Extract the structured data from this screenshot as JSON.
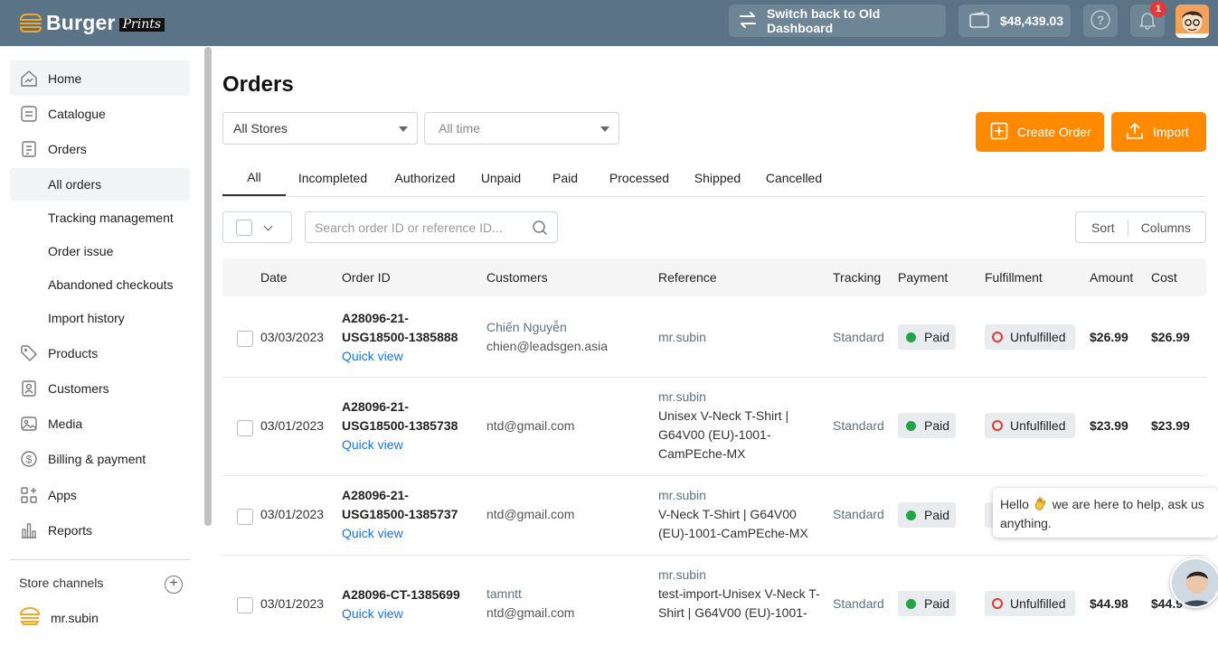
{
  "brand": {
    "name": "Burger",
    "tag": "Prints",
    "accent": "#ff8a00",
    "header_bg": "#5b7386"
  },
  "topbar": {
    "switch_label": "Switch back to Old Dashboard",
    "balance": "$48,439.03",
    "notifications_count": "1"
  },
  "sidebar": {
    "items": [
      {
        "label": "Home",
        "icon": "home-chart-icon"
      },
      {
        "label": "Catalogue",
        "icon": "catalogue-icon"
      },
      {
        "label": "Orders",
        "icon": "orders-icon"
      },
      {
        "label": "Products",
        "icon": "tag-icon"
      },
      {
        "label": "Customers",
        "icon": "customers-icon"
      },
      {
        "label": "Media",
        "icon": "media-icon"
      },
      {
        "label": "Billing & payment",
        "icon": "dollar-icon"
      },
      {
        "label": "Apps",
        "icon": "apps-icon"
      },
      {
        "label": "Reports",
        "icon": "reports-icon"
      }
    ],
    "order_subitems": [
      "All orders",
      "Tracking management",
      "Order issue",
      "Abandoned checkouts",
      "Import history"
    ],
    "store_channels_title": "Store channels",
    "store_name": "mr.subin"
  },
  "page": {
    "title": "Orders",
    "store_filter": "All Stores",
    "time_filter": "All time",
    "create_label": "Create Order",
    "import_label": "Import",
    "search_placeholder": "Search order ID or reference ID...",
    "sort_label": "Sort",
    "columns_label": "Columns"
  },
  "tabs": [
    "All",
    "Incompleted",
    "Authorized",
    "Unpaid",
    "Paid",
    "Processed",
    "Shipped",
    "Cancelled"
  ],
  "table": {
    "headers": [
      "Date",
      "Order ID",
      "Customers",
      "Reference",
      "Tracking",
      "Payment",
      "Fulfillment",
      "Amount",
      "Cost"
    ],
    "rows": [
      {
        "date": "03/03/2023",
        "id1": "A28096-21-",
        "id2": "USG18500-1385888",
        "quick": "Quick view",
        "cust_name": "Chiến Nguyễn",
        "email": "chien@leadsgen.asia",
        "store": "mr.subin",
        "ref": "",
        "tracking": "Standard",
        "payment": "Paid",
        "fulfillment": "Unfulfilled",
        "amount": "$26.99",
        "cost": "$26.99"
      },
      {
        "date": "03/01/2023",
        "id1": "A28096-21-",
        "id2": "USG18500-1385738",
        "quick": "Quick view",
        "cust_name": "",
        "email": "ntd@gmail.com",
        "store": "mr.subin",
        "ref": "Unisex V-Neck T-Shirt | G64V00 (EU)-1001-CamPEche-MX",
        "tracking": "Standard",
        "payment": "Paid",
        "fulfillment": "Unfulfilled",
        "amount": "$23.99",
        "cost": "$23.99"
      },
      {
        "date": "03/01/2023",
        "id1": "A28096-21-",
        "id2": "USG18500-1385737",
        "quick": "Quick view",
        "cust_name": "",
        "email": "ntd@gmail.com",
        "store": "mr.subin",
        "ref": "V-Neck T-Shirt | G64V00 (EU)-1001-CamPEche-MX",
        "tracking": "Standard",
        "payment": "Paid",
        "fulfillment": "",
        "amount": "",
        "cost": ""
      },
      {
        "date": "03/01/2023",
        "id1": "A28096-CT-1385699",
        "id2": "",
        "quick": "Quick view",
        "cust_name": "tamntt",
        "email": "ntd@gmail.com",
        "store": "mr.subin",
        "ref": "test-import-Unisex V-Neck T-Shirt | G64V00 (EU)-1001-",
        "tracking": "Standard",
        "payment": "Paid",
        "fulfillment": "Unfulfilled",
        "amount": "$44.98",
        "cost": "$44.9"
      }
    ]
  },
  "chat": {
    "message_a": "Hello",
    "message_b": "we are here to help, ask us anything."
  }
}
